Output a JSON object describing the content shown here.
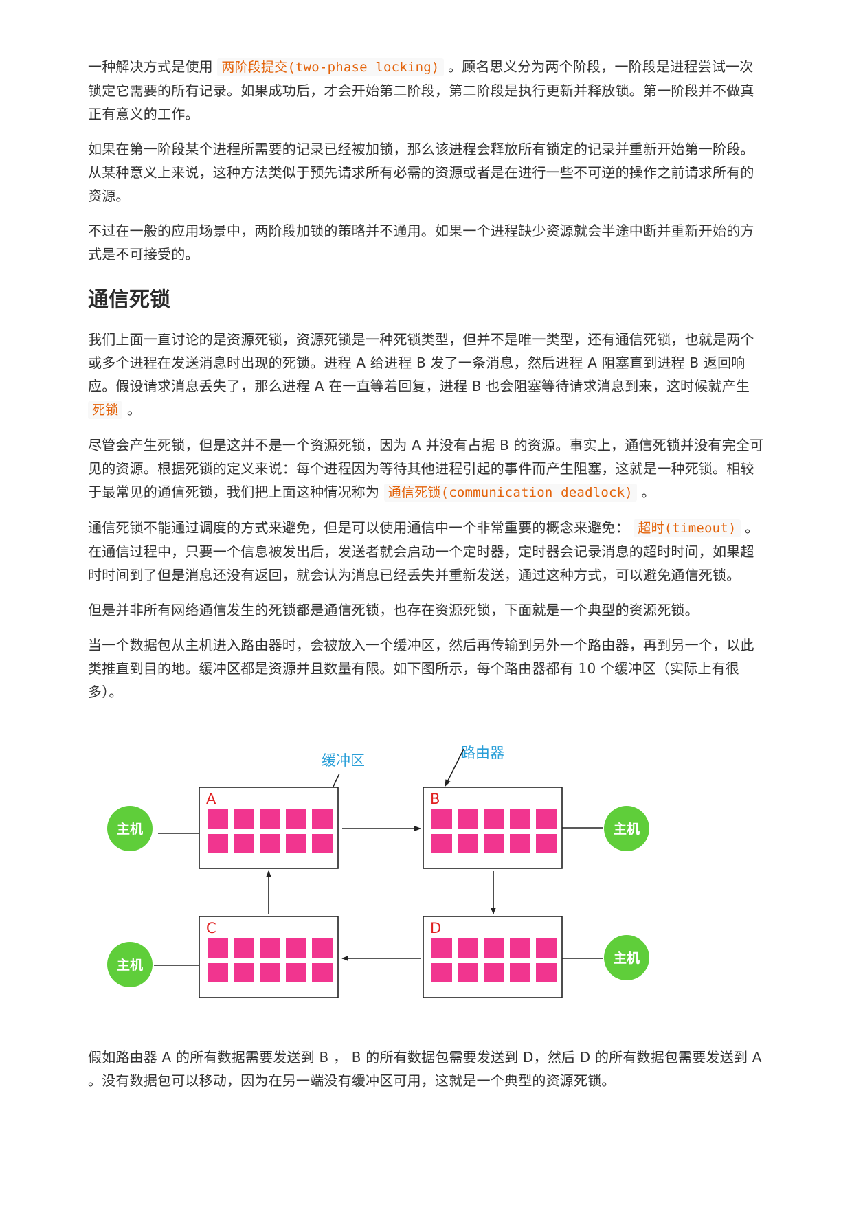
{
  "paragraphs": {
    "p1": {
      "before": "一种解决方式是使用",
      "code": "两阶段提交(two-phase locking)",
      "after": "。顾名思义分为两个阶段，一阶段是进程尝试一次锁定它需要的所有记录。如果成功后，才会开始第二阶段，第二阶段是执行更新并释放锁。第一阶段并不做真正有意义的工作。"
    },
    "p2": "如果在第一阶段某个进程所需要的记录已经被加锁，那么该进程会释放所有锁定的记录并重新开始第一阶段。从某种意义上来说，这种方法类似于预先请求所有必需的资源或者是在进行一些不可逆的操作之前请求所有的资源。",
    "p3": "不过在一般的应用场景中，两阶段加锁的策略并不通用。如果一个进程缺少资源就会半途中断并重新开始的方式是不可接受的。",
    "heading": "通信死锁",
    "p4": {
      "before": "我们上面一直讨论的是资源死锁，资源死锁是一种死锁类型，但并不是唯一类型，还有通信死锁，也就是两个或多个进程在发送消息时出现的死锁。进程 A 给进程 B 发了一条消息，然后进程 A 阻塞直到进程 B 返回响应。假设请求消息丢失了，那么进程 A 在一直等着回复，进程 B 也会阻塞等待请求消息到来，这时候就产生",
      "code": "死锁",
      "after": "。"
    },
    "p5": {
      "before": "尽管会产生死锁，但是这并不是一个资源死锁，因为 A 并没有占据 B 的资源。事实上，通信死锁并没有完全可见的资源。根据死锁的定义来说：每个进程因为等待其他进程引起的事件而产生阻塞，这就是一种死锁。相较于最常见的通信死锁，我们把上面这种情况称为",
      "code": "通信死锁(communication deadlock)",
      "after": "。"
    },
    "p6": {
      "before": "通信死锁不能通过调度的方式来避免，但是可以使用通信中一个非常重要的概念来避免：",
      "code": "超时(timeout)",
      "after": "。在通信过程中，只要一个信息被发出后，发送者就会启动一个定时器，定时器会记录消息的超时时间，如果超时时间到了但是消息还没有返回，就会认为消息已经丢失并重新发送，通过这种方式，可以避免通信死锁。"
    },
    "p7": "但是并非所有网络通信发生的死锁都是通信死锁，也存在资源死锁，下面就是一个典型的资源死锁。",
    "p8": "当一个数据包从主机进入路由器时，会被放入一个缓冲区，然后再传输到另外一个路由器，再到另一个，以此类推直到目的地。缓冲区都是资源并且数量有限。如下图所示，每个路由器都有 10 个缓冲区（实际上有很多）。",
    "p9": "假如路由器 A 的所有数据需要发送到 B ， B 的所有数据包需要发送到 D，然后 D 的所有数据包需要发送到 A 。没有数据包可以移动，因为在另一端没有缓冲区可用，这就是一个典型的资源死锁。"
  },
  "diagram": {
    "buffer_label": "缓冲区",
    "router_label": "路由器",
    "routers": [
      "A",
      "B",
      "C",
      "D"
    ],
    "host_label": "主机",
    "colors": {
      "buffer": "#f1358f",
      "host": "#5fce3a",
      "router_letter": "#e02020",
      "annotation": "#2a9fd8",
      "code": "#e36209"
    }
  }
}
